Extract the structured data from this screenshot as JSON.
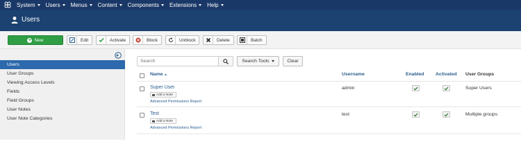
{
  "topnav": {
    "menus": [
      "System",
      "Users",
      "Menus",
      "Content",
      "Components",
      "Extensions",
      "Help"
    ]
  },
  "header": {
    "title": "Users"
  },
  "toolbar": {
    "new_label": "New",
    "edit_label": "Edit",
    "activate_label": "Activate",
    "block_label": "Block",
    "unblock_label": "Unblock",
    "delete_label": "Delete",
    "batch_label": "Batch"
  },
  "sidebar": {
    "items": [
      {
        "label": "Users",
        "active": true
      },
      {
        "label": "User Groups"
      },
      {
        "label": "Viewing Access Levels"
      },
      {
        "label": "Fields"
      },
      {
        "label": "Field Groups"
      },
      {
        "label": "User Notes"
      },
      {
        "label": "User Note Categories"
      }
    ]
  },
  "search": {
    "placeholder": "Search",
    "tools_label": "Search Tools",
    "clear_label": "Clear"
  },
  "table": {
    "columns": {
      "name": "Name",
      "sort_indicator": "▲",
      "username": "Username",
      "enabled": "Enabled",
      "activated": "Activated",
      "user_groups": "User Groups"
    },
    "rows": [
      {
        "name": "Super User",
        "note_label": "Add a Note",
        "permissions_link": "Advanced Permissions Report",
        "username": "admin",
        "groups": "Super Users"
      },
      {
        "name": "Test",
        "note_label": "Add a Note",
        "permissions_link": "Advanced Permissions Report",
        "username": "test",
        "groups": "Multiple groups"
      }
    ]
  },
  "colors": {
    "topnav_bg": "#1a3867",
    "header_bg": "#1b4270",
    "new_button": "#2f9e44",
    "sidebar_active": "#2d69ad",
    "link": "#2a5d8f"
  }
}
